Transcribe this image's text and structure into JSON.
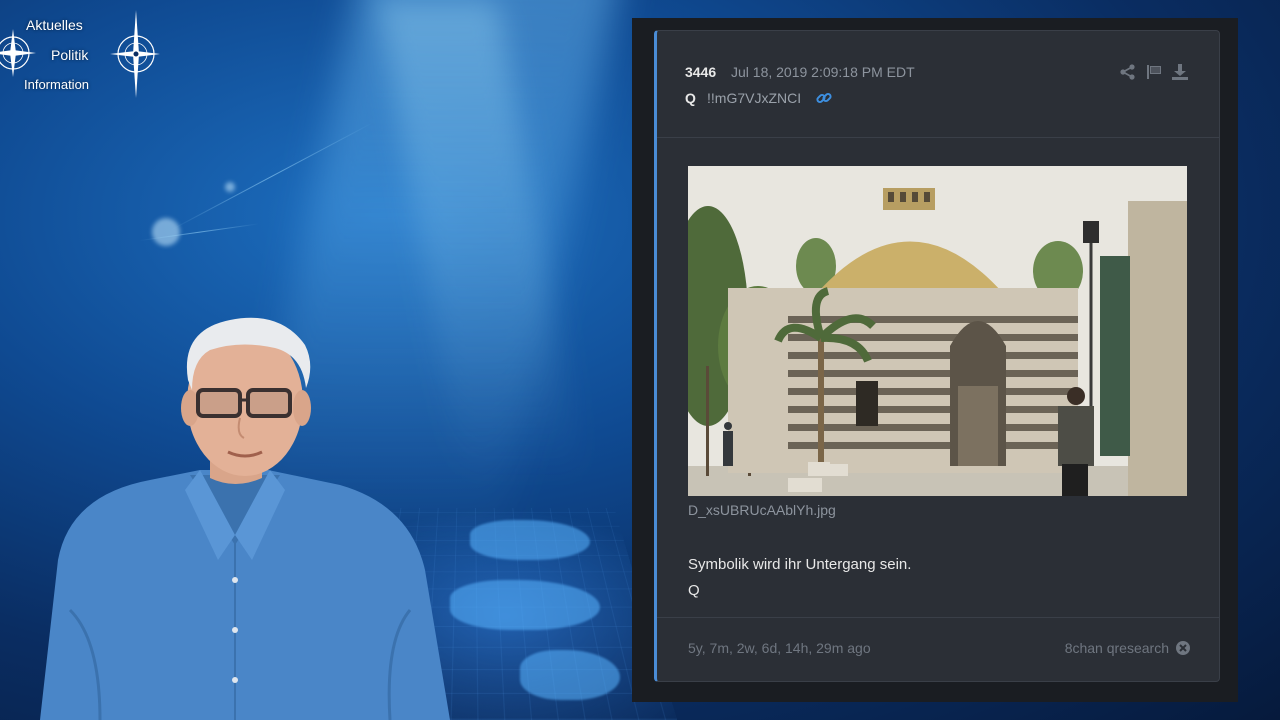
{
  "logo": {
    "line1": "Aktuelles",
    "line2": "Politik",
    "line3": "Information",
    "icon": "compass-icon"
  },
  "post": {
    "number": "3446",
    "date": "Jul 18, 2019 2:09:18 PM EDT",
    "author": "Q",
    "tripcode": "!!mG7VJxZNCI",
    "filename": "D_xsUBRUcAAblYh.jpg",
    "message_line1": "Symbolik wird ihr Untergang sein.",
    "message_line2": "Q",
    "ago": "5y, 7m, 2w, 6d, 14h, 29m ago",
    "source": "8chan qresearch",
    "icons": [
      "share-icon",
      "flag-icon",
      "download-icon",
      "link-icon",
      "close-circle-icon"
    ]
  },
  "colors": {
    "panel_bg": "#1a1d22",
    "card_bg": "#2b2f36",
    "accent": "#4a8cd6",
    "link": "#3d8fe0"
  }
}
